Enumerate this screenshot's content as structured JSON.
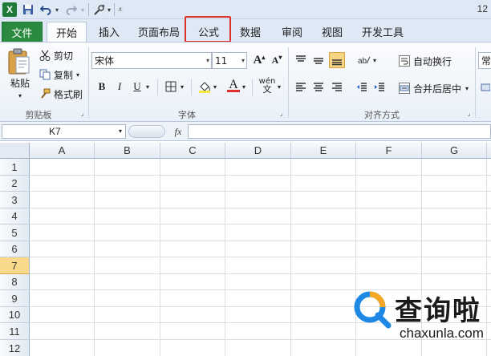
{
  "app": {
    "logo_letter": "X",
    "window_number": "12"
  },
  "qat": {
    "save_icon": "save-icon",
    "undo_icon": "undo-icon",
    "redo_icon": "redo-icon",
    "customize_icon": "customize-icon"
  },
  "tabs": [
    {
      "label": "文件"
    },
    {
      "label": "开始"
    },
    {
      "label": "插入"
    },
    {
      "label": "页面布局"
    },
    {
      "label": "公式"
    },
    {
      "label": "数据"
    },
    {
      "label": "审阅"
    },
    {
      "label": "视图"
    },
    {
      "label": "开发工具"
    }
  ],
  "clipboard": {
    "paste_label": "粘贴",
    "cut_label": "剪切",
    "copy_label": "复制",
    "format_painter_label": "格式刷",
    "group_label": "剪贴板"
  },
  "font": {
    "font_name": "宋体",
    "font_size": "11",
    "grow_label": "A",
    "shrink_label": "A",
    "bold_label": "B",
    "italic_label": "I",
    "underline_label": "U",
    "font_color_label": "A",
    "wen_label": "wén",
    "group_label": "字体"
  },
  "alignment": {
    "wrap_text_label": "自动换行",
    "merge_center_label": "合并后居中",
    "group_label": "对齐方式"
  },
  "number": {
    "format_label": "常"
  },
  "formula_bar": {
    "name_box": "K7",
    "fx_label": "fx",
    "formula": ""
  },
  "grid": {
    "columns": [
      "A",
      "B",
      "C",
      "D",
      "E",
      "F",
      "G"
    ],
    "rows": [
      "1",
      "2",
      "3",
      "4",
      "5",
      "6",
      "7",
      "8",
      "9",
      "10",
      "11",
      "12"
    ],
    "selected_row": "7"
  },
  "watermark": {
    "cn": "查询啦",
    "en": "chaxunla.com"
  },
  "colors": {
    "file_tab": "#2a8a3f",
    "highlight": "#e0302d",
    "selected_row": "#f9d98c",
    "accent_blue": "#1e88e5",
    "accent_orange": "#f5a623"
  }
}
